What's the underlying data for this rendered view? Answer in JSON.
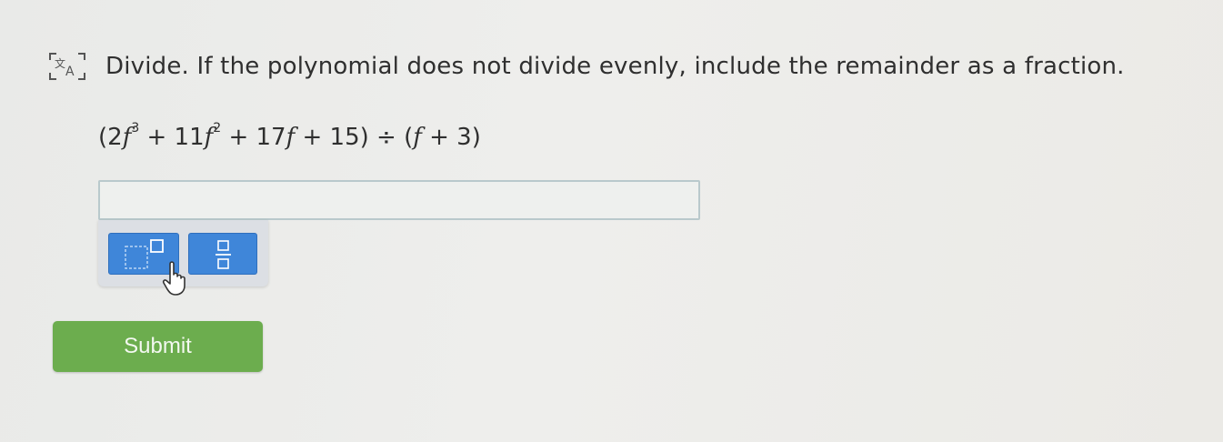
{
  "question": {
    "instruction": "Divide. If the polynomial does not divide evenly, include the remainder as a fraction.",
    "expression": {
      "open": "(2",
      "var1": "f",
      "exp1": "3",
      "mid1": " + 11",
      "var2": "f",
      "exp2": "2",
      "mid2": " + 17",
      "var3": "f",
      "mid3": " + 15) ÷ (",
      "var4": "f",
      "close": " + 3)"
    }
  },
  "answer": {
    "value": ""
  },
  "icons": {
    "translate": "translate-icon",
    "exponent_key": "exponent-template-icon",
    "fraction_key": "fraction-template-icon",
    "cursor": "hand-pointer-icon"
  },
  "actions": {
    "submit_label": "Submit"
  },
  "colors": {
    "key_blue": "#3f86d9",
    "submit_green": "#6cad4e",
    "input_border": "#b9c9cc"
  }
}
